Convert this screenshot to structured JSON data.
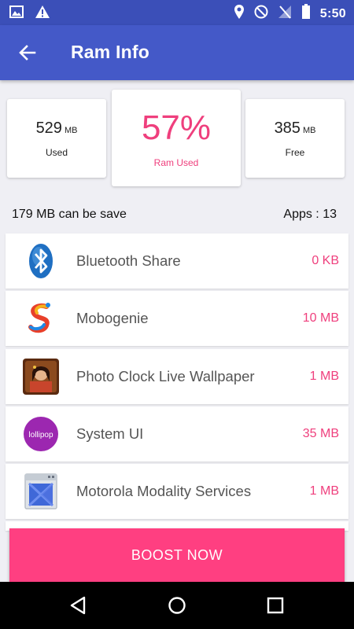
{
  "status_bar": {
    "time": "5:50",
    "left_icons": [
      "image-icon",
      "warning-icon"
    ],
    "right_icons": [
      "location-icon",
      "do-not-disturb-icon",
      "no-signal-icon",
      "battery-icon"
    ]
  },
  "app_bar": {
    "title": "Ram Info",
    "back_icon": "arrow-left-icon"
  },
  "stats": {
    "used": {
      "value": "529",
      "unit": "MB",
      "label": "Used"
    },
    "percent": {
      "value": "57%",
      "label": "Ram Used"
    },
    "free": {
      "value": "385",
      "unit": "MB",
      "label": "Free"
    }
  },
  "summary": {
    "saveable": "179 MB can be save",
    "apps_count": "Apps : 13"
  },
  "apps": [
    {
      "name": "Bluetooth Share",
      "size": "0 KB",
      "icon": "bluetooth-icon"
    },
    {
      "name": "Mobogenie",
      "size": "10 MB",
      "icon": "mobogenie-icon"
    },
    {
      "name": "Photo Clock Live Wallpaper",
      "size": "1 MB",
      "icon": "photo-clock-icon"
    },
    {
      "name": "System UI",
      "size": "35 MB",
      "icon": "lollipop-icon",
      "icon_text": "lollipop"
    },
    {
      "name": "Motorola Modality Services",
      "size": "1 MB",
      "icon": "motorola-modality-icon"
    }
  ],
  "boost_button": {
    "label": "BOOST NOW"
  },
  "nav_bar": {
    "icons": [
      "back-triangle-icon",
      "home-circle-icon",
      "recents-square-icon"
    ]
  },
  "colors": {
    "status_bar": "#3b4fb8",
    "app_bar": "#4459c8",
    "accent_pink": "#ef3f7d",
    "boost_button": "#ff3f81",
    "background": "#efeff4"
  }
}
